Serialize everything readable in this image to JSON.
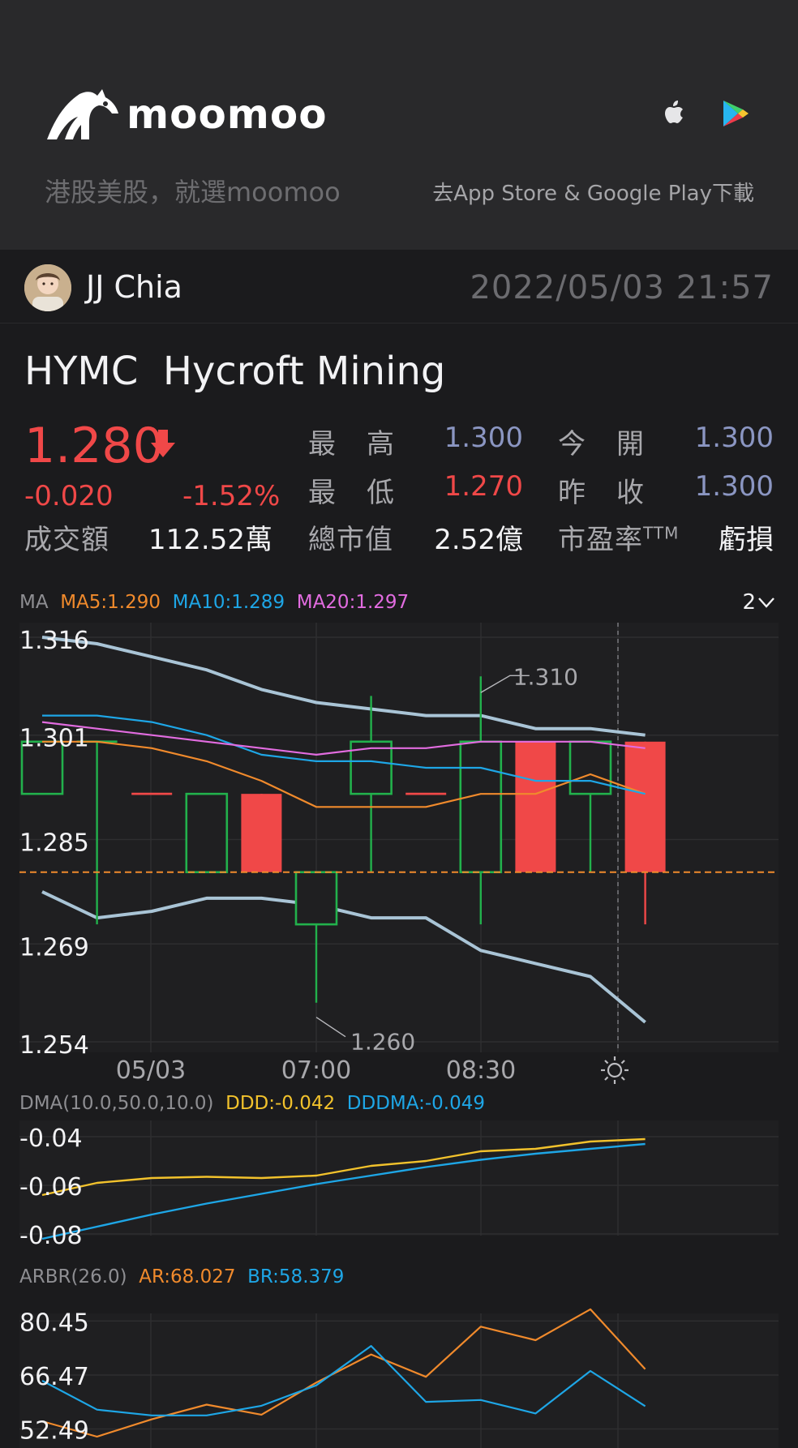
{
  "banner": {
    "brand": "moomoo",
    "slogan": "港股美股，就選moomoo",
    "store_text": "去App Store & Google Play下載"
  },
  "author": {
    "name": "JJ Chia",
    "time": "2022/05/03  21:57"
  },
  "quote": {
    "symbol": "HYMC",
    "name": "Hycroft Mining",
    "price": "1.280",
    "change": "-0.020",
    "change_pct": "-1.52%",
    "high_label": "最　高",
    "high": "1.300",
    "open_label": "今　開",
    "open": "1.300",
    "low_label": "最　低",
    "low": "1.270",
    "prev_close_label": "昨　收",
    "prev_close": "1.300",
    "turnover_label": "成交額",
    "turnover": "112.52萬",
    "mcap_label": "總市值",
    "mcap": "2.52億",
    "pe_label": "市盈率",
    "pe_sup": "TTM",
    "pe": "虧損"
  },
  "ma_indicator": {
    "label": "MA",
    "ma5": "MA5:1.290",
    "ma10": "MA10:1.289",
    "ma20": "MA20:1.297",
    "period": "2"
  },
  "dma_indicator": {
    "label": "DMA(10.0,50.0,10.0)",
    "ddd": "DDD:-0.042",
    "dddma": "DDDMA:-0.049"
  },
  "arbr_indicator": {
    "label": "ARBR(26.0)",
    "ar": "AR:68.027",
    "br": "BR:58.379"
  },
  "colors": {
    "up": "#f04848",
    "down": "#22b14c",
    "ma5": "#f08a2c",
    "ma10": "#1ea6e6",
    "ma20": "#e26ce0",
    "band": "#a9c4d6"
  },
  "chart_data": [
    {
      "type": "candlestick",
      "y_ticks": [
        "1.316",
        "1.301",
        "1.285",
        "1.269",
        "1.254"
      ],
      "ylim": [
        1.254,
        1.316
      ],
      "x_ticks": [
        "05/03",
        "07:00",
        "08:30"
      ],
      "annotations": [
        "1.310",
        "1.260"
      ],
      "last_price": 1.28,
      "candles": [
        {
          "o": 1.292,
          "c": 1.3,
          "h": 1.3,
          "l": 1.292,
          "dir": "down"
        },
        {
          "o": 1.3,
          "c": 1.3,
          "h": 1.3,
          "l": 1.272,
          "dir": "down"
        },
        {
          "o": 1.292,
          "c": 1.292,
          "h": 1.292,
          "l": 1.292,
          "dir": "up"
        },
        {
          "o": 1.28,
          "c": 1.292,
          "h": 1.292,
          "l": 1.28,
          "dir": "down"
        },
        {
          "o": 1.292,
          "c": 1.28,
          "h": 1.292,
          "l": 1.28,
          "dir": "up"
        },
        {
          "o": 1.272,
          "c": 1.28,
          "h": 1.28,
          "l": 1.26,
          "dir": "down"
        },
        {
          "o": 1.292,
          "c": 1.3,
          "h": 1.307,
          "l": 1.28,
          "dir": "down"
        },
        {
          "o": 1.292,
          "c": 1.292,
          "h": 1.292,
          "l": 1.292,
          "dir": "up"
        },
        {
          "o": 1.28,
          "c": 1.3,
          "h": 1.31,
          "l": 1.272,
          "dir": "down"
        },
        {
          "o": 1.3,
          "c": 1.28,
          "h": 1.3,
          "l": 1.28,
          "dir": "up"
        },
        {
          "o": 1.292,
          "c": 1.3,
          "h": 1.3,
          "l": 1.28,
          "dir": "down"
        },
        {
          "o": 1.3,
          "c": 1.28,
          "h": 1.3,
          "l": 1.272,
          "dir": "up"
        }
      ],
      "series": [
        {
          "values": [
            1.316,
            1.315,
            1.313,
            1.311,
            1.308,
            1.306,
            1.305,
            1.304,
            1.304,
            1.302,
            1.302,
            1.301
          ]
        },
        {
          "values": [
            1.277,
            1.273,
            1.274,
            1.276,
            1.276,
            1.275,
            1.273,
            1.273,
            1.268,
            1.266,
            1.264,
            1.257
          ]
        },
        {
          "name": "MA5",
          "values": [
            1.3,
            1.3,
            1.299,
            1.297,
            1.294,
            1.29,
            1.29,
            1.29,
            1.292,
            1.292,
            1.295,
            1.292
          ]
        },
        {
          "name": "MA10",
          "values": [
            1.304,
            1.304,
            1.303,
            1.301,
            1.298,
            1.297,
            1.297,
            1.296,
            1.296,
            1.294,
            1.294,
            1.292
          ]
        },
        {
          "name": "MA20",
          "values": [
            1.303,
            1.302,
            1.301,
            1.3,
            1.299,
            1.298,
            1.299,
            1.299,
            1.3,
            1.3,
            1.3,
            1.299
          ]
        }
      ]
    },
    {
      "type": "line",
      "y_ticks": [
        "-0.04",
        "-0.06",
        "-0.08"
      ],
      "ylim": [
        -0.08,
        -0.036
      ],
      "series": [
        {
          "name": "DDD",
          "values": [
            -0.064,
            -0.059,
            -0.057,
            -0.0565,
            -0.057,
            -0.056,
            -0.052,
            -0.05,
            -0.046,
            -0.045,
            -0.042,
            -0.041
          ]
        },
        {
          "name": "DDDMA",
          "values": [
            -0.082,
            -0.077,
            -0.072,
            -0.0675,
            -0.0635,
            -0.0595,
            -0.056,
            -0.0525,
            -0.0495,
            -0.047,
            -0.045,
            -0.043
          ]
        }
      ]
    },
    {
      "type": "line",
      "y_ticks": [
        "80.45",
        "66.47",
        "52.49"
      ],
      "ylim": [
        50.5,
        82.0
      ],
      "series": [
        {
          "name": "AR",
          "values": [
            54.5,
            50.5,
            55.0,
            58.8,
            56.2,
            64.5,
            71.8,
            66.0,
            79.0,
            75.5,
            83.5,
            68.0
          ]
        },
        {
          "name": "BR",
          "values": [
            65.0,
            57.5,
            56.0,
            56.0,
            58.5,
            63.8,
            74.0,
            59.5,
            60.0,
            56.5,
            67.5,
            58.4
          ]
        }
      ]
    }
  ]
}
